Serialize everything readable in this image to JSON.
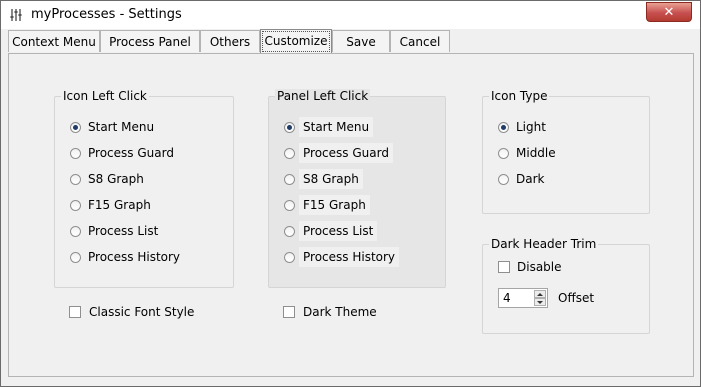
{
  "window": {
    "title": "myProcesses - Settings",
    "close_label": "✕"
  },
  "tabs": [
    {
      "label": "Context Menu",
      "active": false
    },
    {
      "label": "Process Panel",
      "active": false
    },
    {
      "label": "Others",
      "active": false
    },
    {
      "label": "Customize",
      "active": true
    },
    {
      "label": "Save",
      "active": false
    },
    {
      "label": "Cancel",
      "active": false
    }
  ],
  "icon_left_click": {
    "title": "Icon Left Click",
    "options": [
      "Start Menu",
      "Process Guard",
      "S8 Graph",
      "F15 Graph",
      "Process List",
      "Process History"
    ],
    "selected": "Start Menu"
  },
  "panel_left_click": {
    "title": "Panel Left Click",
    "options": [
      "Start Menu",
      "Process Guard",
      "S8 Graph",
      "F15 Graph",
      "Process List",
      "Process History"
    ],
    "selected": "Start Menu"
  },
  "icon_type": {
    "title": "Icon Type",
    "options": [
      "Light",
      "Middle",
      "Dark"
    ],
    "selected": "Light"
  },
  "dark_header_trim": {
    "title": "Dark Header Trim",
    "disable_label": "Disable",
    "disable_checked": false,
    "offset_value": "4",
    "offset_label": "Offset"
  },
  "classic_font_style": {
    "label": "Classic Font Style",
    "checked": false
  },
  "dark_theme": {
    "label": "Dark Theme",
    "checked": false
  }
}
